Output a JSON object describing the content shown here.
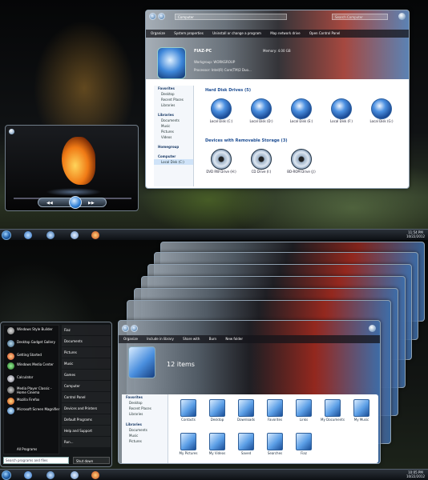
{
  "top": {
    "explorer": {
      "address": "Computer",
      "search_placeholder": "Search Computer",
      "toolbar": [
        "Organize",
        "System properties",
        "Uninstall or change a program",
        "Map network drive",
        "Open Control Panel"
      ],
      "pc_name": "FIAZ-PC",
      "memory": "Memory: 4.00 GB",
      "workgroup": "Workgroup: WORKGROUP",
      "processor": "Processor: Intel(R) Core(TM)2 Duo...",
      "nav": [
        "Favorites",
        "Desktop",
        "Recent Places",
        "Libraries",
        "Libraries",
        "Documents",
        "Music",
        "Pictures",
        "Videos",
        "Homegroup",
        "Computer",
        "Local Disk (C:)"
      ],
      "hard_disk_header": "Hard Disk Drives (5)",
      "hard_disks": [
        "Local Disk (C:)",
        "Local Disk (D:)",
        "Local Disk (E:)",
        "Local Disk (F:)",
        "Local Disk (G:)"
      ],
      "removable_header": "Devices with Removable Storage (3)",
      "removable": [
        "DVD RW Drive (H:)",
        "CD Drive (I:)",
        "BD-ROM Drive (J:)"
      ]
    },
    "clock": {
      "time": "11:54 PM",
      "date": "10/22/2012"
    }
  },
  "bottom": {
    "startmenu": {
      "programs": [
        "Windows Style Builder",
        "Desktop Gadget Gallery",
        "Getting Started",
        "Windows Media Center",
        "Calculator",
        "Media Player Classic - Home Cinema",
        "Mozilla Firefox",
        "Microsoft Screen Magnifier"
      ],
      "all_programs": "All Programs",
      "right_items": [
        "Fiaz",
        "Documents",
        "Pictures",
        "Music",
        "Games",
        "Computer",
        "Control Panel",
        "Devices and Printers",
        "Default Programs",
        "Help and Support",
        "Run..."
      ],
      "search_placeholder": "Search programs and files",
      "shutdown": "Shut down"
    },
    "library": {
      "toolbar": [
        "Organize",
        "Include in library",
        "Share with",
        "Burn",
        "New folder"
      ],
      "count": "12 items",
      "nav": [
        "Favorites",
        "Desktop",
        "Recent Places",
        "Libraries",
        "Libraries",
        "Documents",
        "Music",
        "Pictures"
      ],
      "folders": [
        "Contacts",
        "Desktop",
        "Downloads",
        "Favorites",
        "Links",
        "My Documents",
        "My Music",
        "My Pictures",
        "My Videos",
        "Saved",
        "Searches",
        "Fiaz"
      ]
    },
    "clock": {
      "time": "10:05 PM",
      "date": "10/22/2012"
    }
  }
}
